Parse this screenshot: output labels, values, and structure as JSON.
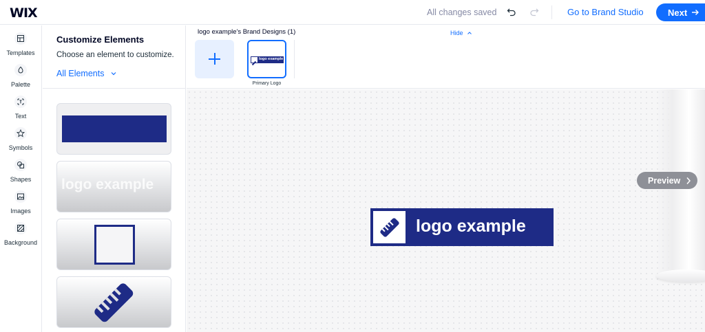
{
  "header": {
    "logo": "WIX",
    "save_status": "All changes saved",
    "brand_studio_link": "Go to Brand Studio",
    "next_label": "Next"
  },
  "leftnav": {
    "items": [
      {
        "label": "Templates",
        "icon": "templates-icon"
      },
      {
        "label": "Palette",
        "icon": "palette-icon"
      },
      {
        "label": "Text",
        "icon": "text-icon"
      },
      {
        "label": "Symbols",
        "icon": "symbols-icon"
      },
      {
        "label": "Shapes",
        "icon": "shapes-icon"
      },
      {
        "label": "Images",
        "icon": "images-icon"
      },
      {
        "label": "Background",
        "icon": "background-icon"
      }
    ]
  },
  "panel": {
    "title": "Customize Elements",
    "subtitle": "Choose an element to customize.",
    "filter_label": "All Elements",
    "cards": [
      {
        "kind": "background-bar"
      },
      {
        "kind": "text",
        "text": "logo example"
      },
      {
        "kind": "shape"
      },
      {
        "kind": "symbol"
      }
    ]
  },
  "designs": {
    "title": "logo example's Brand Designs (1)",
    "hide_label": "Hide",
    "primary_label": "Primary Logo",
    "thumb_text": "logo example"
  },
  "canvas": {
    "preview_label": "Preview",
    "logo_text": "logo example"
  },
  "colors": {
    "accent": "#116dff",
    "brand_navy": "#1e2b86"
  }
}
